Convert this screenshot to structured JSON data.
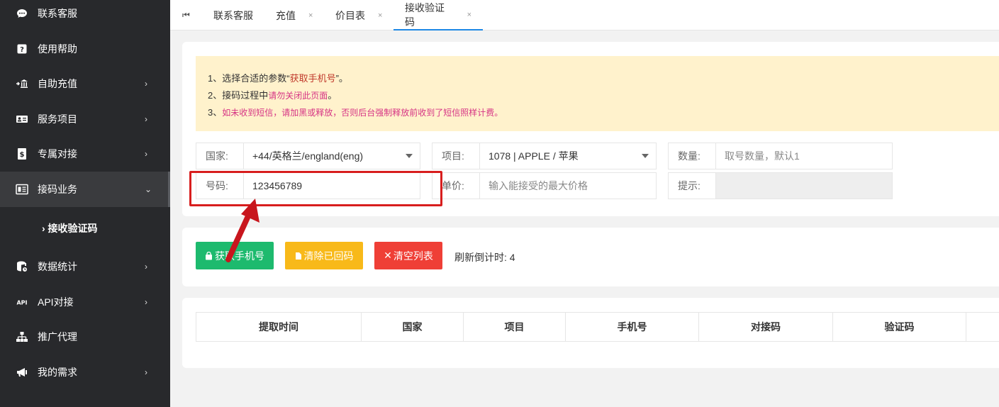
{
  "sidebar": {
    "items": [
      {
        "label": "联系客服",
        "icon": "chat-icon",
        "chevron": ""
      },
      {
        "label": "使用帮助",
        "icon": "help-icon",
        "chevron": ""
      },
      {
        "label": "自助充值",
        "icon": "bank-icon",
        "chevron": "›"
      },
      {
        "label": "服务项目",
        "icon": "id-card-icon",
        "chevron": "›"
      },
      {
        "label": "专属对接",
        "icon": "dollar-doc-icon",
        "chevron": "›"
      },
      {
        "label": "接码业务",
        "icon": "sms-code-icon",
        "chevron": "⌄"
      },
      {
        "label": "数据统计",
        "icon": "database-icon",
        "chevron": "›"
      },
      {
        "label": "API对接",
        "icon": "api-icon",
        "chevron": "›"
      },
      {
        "label": "推广代理",
        "icon": "sitemap-icon",
        "chevron": ""
      },
      {
        "label": "我的需求",
        "icon": "megaphone-icon",
        "chevron": "›"
      }
    ],
    "sub_item": "› 接收验证码"
  },
  "tabs": [
    {
      "label": "联系客服",
      "closable": false
    },
    {
      "label": "充值",
      "closable": true
    },
    {
      "label": "价目表",
      "closable": true
    },
    {
      "label": "接收验证码",
      "closable": true
    }
  ],
  "tab_close": "×",
  "notice": {
    "line1_prefix": "1、选择合适的参数“",
    "line1_red": "获取手机号",
    "line1_suffix": "”。",
    "line2_prefix": "2、接码过程中",
    "line2_pink": "请勿关闭此页面",
    "line2_suffix": "。",
    "line3_prefix": "3、",
    "line3_pink": "如未收到短信，请加黑或释放，否则后台强制释放前收到了短信照样计费。"
  },
  "form": {
    "country_label": "国家:",
    "country_value": "+44/英格兰/england(eng)",
    "project_label": "项目:",
    "project_value": "1078 | APPLE / 苹果",
    "quantity_label": "数量:",
    "quantity_placeholder": "取号数量，默认1",
    "number_label": "号码:",
    "number_value": "123456789",
    "price_label": "单价:",
    "price_placeholder": "输入能接受的最大价格",
    "hint_label": "提示:"
  },
  "actions": {
    "get_number": "获取手机号",
    "clear_returned": "清除已回码",
    "clear_list": "清空列表",
    "countdown_label": "刷新倒计时:",
    "countdown_value": "4"
  },
  "table": {
    "headers": [
      "提取时间",
      "国家",
      "项目",
      "手机号",
      "对接码",
      "验证码"
    ]
  },
  "colors": {
    "sidebar_bg": "#28292c",
    "green": "#1dba6e",
    "yellow": "#f8b919",
    "red": "#ef3f36",
    "notice_bg": "#fff2cc",
    "tab_active": "#1e88e5"
  }
}
